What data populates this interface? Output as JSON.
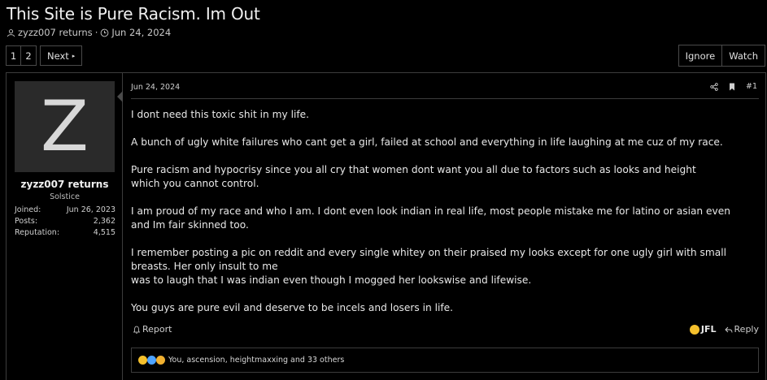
{
  "thread": {
    "title": "This Site is Pure Racism. Im Out",
    "author": "zyzz007 returns",
    "separator": "·",
    "date": "Jun 24, 2024"
  },
  "pagination": {
    "pages": [
      "1",
      "2"
    ],
    "next_label": "Next",
    "next_caret": "▸"
  },
  "thread_actions": {
    "ignore_label": "Ignore",
    "watch_label": "Watch"
  },
  "user": {
    "avatar_letter": "Z",
    "name": "zyzz007 returns",
    "title": "Solstice",
    "stats": [
      {
        "label": "Joined:",
        "value": "Jun 26, 2023"
      },
      {
        "label": "Posts:",
        "value": "2,362"
      },
      {
        "label": "Reputation:",
        "value": "4,515"
      }
    ]
  },
  "post": {
    "date": "Jun 24, 2024",
    "number": "#1",
    "paragraphs": [
      "I dont need this toxic shit in my life.",
      "A bunch of ugly white failures who cant get a girl, failed at school and everything in life laughing at me cuz of my race.",
      "Pure racism and hypocrisy since you all cry that women dont want you all due to factors such as looks and height which you cannot control.",
      "I am proud of my race and who I am. I dont even look indian in real life, most people mistake me for latino or asian even and Im fair skinned too.",
      "I remember posting a pic on reddit and every single whitey on their praised my looks except for one ugly girl with small breasts. Her only insult to me\nwas to laugh that I was indian even though I mogged her lookswise and lifewise.",
      "You guys are pure evil and deserve to be incels and losers in life."
    ]
  },
  "footer": {
    "report_label": "Report",
    "jfl_label": "JFL",
    "reply_label": "Reply"
  },
  "reactions": {
    "summary": "You, ascension, heightmaxxing and 33 others"
  },
  "colors": {
    "background": "#000000",
    "border": "#3c3c3c",
    "avatar_bg": "#2a2a2a",
    "emoji_yellow": "#f5c02c"
  }
}
